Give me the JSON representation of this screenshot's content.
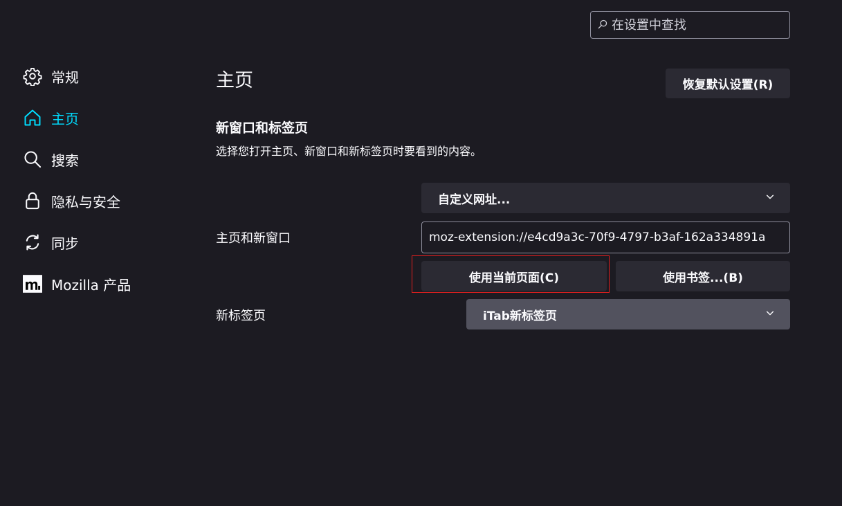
{
  "search": {
    "placeholder": "在设置中查找",
    "icon": "search-icon"
  },
  "sidebar": {
    "items": [
      {
        "label": "常规",
        "icon": "gear-icon",
        "active": false
      },
      {
        "label": "主页",
        "icon": "home-icon",
        "active": true
      },
      {
        "label": "搜索",
        "icon": "search-icon",
        "active": false
      },
      {
        "label": "隐私与安全",
        "icon": "lock-icon",
        "active": false
      },
      {
        "label": "同步",
        "icon": "sync-icon",
        "active": false
      },
      {
        "label": "Mozilla 产品",
        "icon": "mozilla-logo-icon",
        "active": false
      }
    ]
  },
  "main": {
    "title": "主页",
    "restore_button": "恢复默认设置(R)",
    "section": {
      "title": "新窗口和标签页",
      "description": "选择您打开主页、新窗口和新标签页时要看到的内容。"
    },
    "homepage": {
      "label": "主页和新窗口",
      "mode": "自定义网址...",
      "url": "moz-extension://e4cd9a3c-70f9-4797-b3af-162a334891a",
      "use_current_button": "使用当前页面(C)",
      "use_bookmark_button": "使用书签...(B)"
    },
    "newtab": {
      "label": "新标签页",
      "value": "iTab新标签页"
    }
  },
  "colors": {
    "background": "#1c1b22",
    "button": "#2b2a33",
    "accent": "#00ddff",
    "highlight": "#e01f1f"
  }
}
